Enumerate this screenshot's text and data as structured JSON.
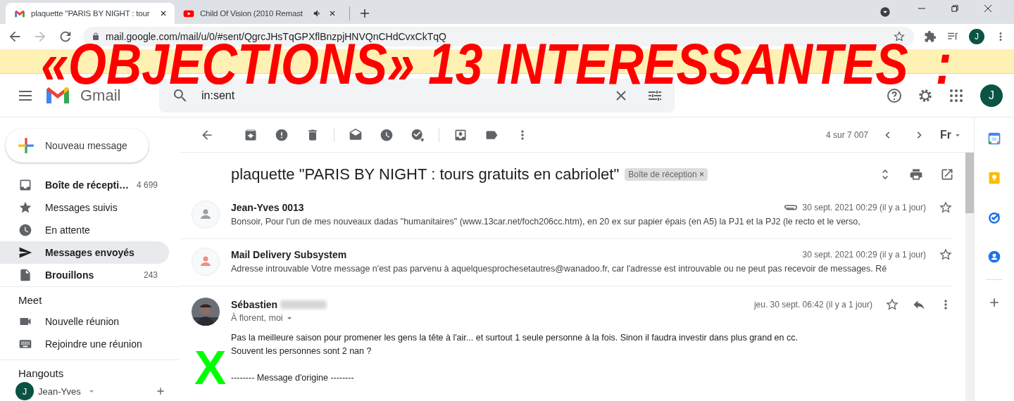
{
  "browser": {
    "tabs": [
      {
        "title": "plaquette \"PARIS BY NIGHT : tour",
        "selected": true,
        "audio": false
      },
      {
        "title": "Child Of Vision (2010 Remast",
        "selected": false,
        "audio": true
      }
    ],
    "url": "mail.google.com/mail/u/0/#sent/QgrcJHsTqGPXflBnzpjHNVQnCHdCvxCkTqQ",
    "profile": "J"
  },
  "overlay": {
    "text": "«OBJECTIONS» 13 INTERESSANTES  :",
    "mark": "X"
  },
  "header": {
    "app": "Gmail",
    "search": "in:sent",
    "avatar": "J"
  },
  "compose": "Nouveau message",
  "nav": [
    {
      "label": "Boîte de récepti…",
      "count": "4 699",
      "bold": true,
      "selected": false
    },
    {
      "label": "Messages suivis",
      "bold": false,
      "selected": false
    },
    {
      "label": "En attente",
      "bold": false,
      "selected": false
    },
    {
      "label": "Messages envoyés",
      "bold": true,
      "selected": true
    },
    {
      "label": "Brouillons",
      "count": "243",
      "bold": true,
      "selected": false
    }
  ],
  "meet": {
    "title": "Meet",
    "items": [
      "Nouvelle réunion",
      "Rejoindre une réunion"
    ]
  },
  "hangouts": {
    "title": "Hangouts",
    "user": "Jean-Yves",
    "avatar": "J"
  },
  "toolbar": {
    "pager": "4 sur 7 007",
    "input_tool": "Fr"
  },
  "thread": {
    "subject": "plaquette \"PARIS BY NIGHT : tours gratuits en cabriolet\"",
    "label": "Boîte de réception",
    "label_remove": "×",
    "messages": [
      {
        "kind": "collapsed",
        "sender": "Jean-Yves 0013",
        "snippet": "Bonsoir, Pour l'un de mes nouveaux dadas \"humanitaires\" (www.13car.net/foch206cc.htm), en 20 ex sur papier épais (en A5) la PJ1 et la PJ2 (le recto et le verso,",
        "date": "30 sept. 2021 00:29 (il y a 1 jour)",
        "attachment": true,
        "color": "#9aa0a6"
      },
      {
        "kind": "collapsed",
        "sender": "Mail Delivery Subsystem",
        "snippet": "Adresse introuvable Votre message n'est pas parvenu à aquelquesprochesetautres@wanadoo.fr, car l'adresse est introuvable ou ne peut pas recevoir de messages. Ré",
        "date": "30 sept. 2021 00:29 (il y a 1 jour)",
        "attachment": false,
        "color": "#ee8f80"
      },
      {
        "kind": "expanded",
        "sender": "Sébastien",
        "recipients": "À florent, moi",
        "date": "jeu. 30 sept. 06:42 (il y a 1 jour)",
        "body": [
          [
            "Pas la meilleure saison pour promener les gens la tête à l'air... et surtout 1 seule personne à la fois. Sinon il faudra investir dans plus grand en cc.",
            "Souvent les personnes sont 2 nan ?"
          ],
          [
            "-------- Message d'origine --------"
          ]
        ]
      }
    ]
  }
}
